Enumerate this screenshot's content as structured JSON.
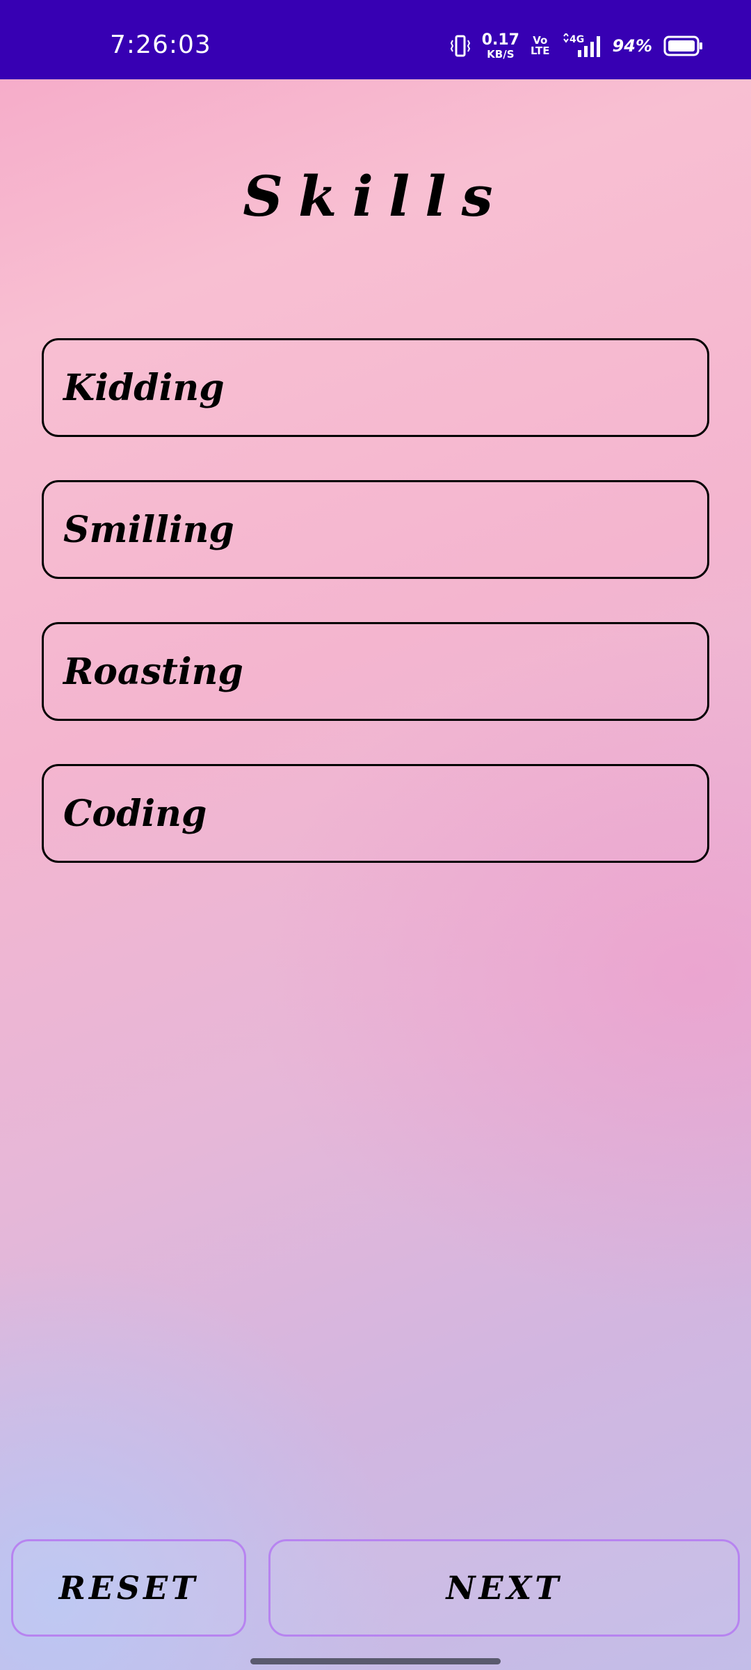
{
  "status_bar": {
    "time": "7:26:03",
    "net_speed_value": "0.17",
    "net_speed_unit": "KB/S",
    "volte_top": "Vo",
    "volte_bottom": "LTE",
    "network": "4G",
    "battery_percent": "94%",
    "background_color": "#3700b3"
  },
  "page": {
    "title": "Skills"
  },
  "skills": [
    {
      "label": "Kidding"
    },
    {
      "label": "Smilling"
    },
    {
      "label": "Roasting"
    },
    {
      "label": "Coding"
    }
  ],
  "actions": {
    "reset_label": "RESET",
    "next_label": "NEXT",
    "button_border_color": "#b784f0"
  }
}
